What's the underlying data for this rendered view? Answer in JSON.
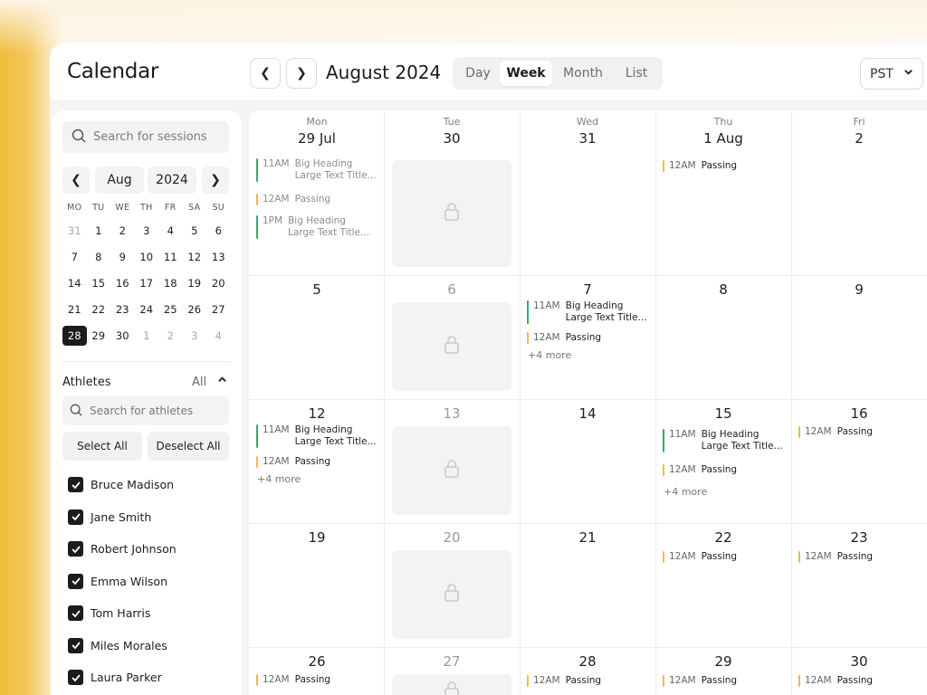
{
  "header": {
    "title": "Calendar",
    "period": "August 2024",
    "views": [
      "Day",
      "Week",
      "Month",
      "List"
    ],
    "active_view": "Week",
    "timezone": "PST"
  },
  "sidebar": {
    "session_search_placeholder": "Search for sessions",
    "mini_month": "Aug",
    "mini_year": "2024",
    "weekdays": [
      "MO",
      "TU",
      "WE",
      "TH",
      "FR",
      "SA",
      "SU"
    ],
    "weeks": [
      [
        "31",
        "1",
        "2",
        "3",
        "4",
        "5",
        "6"
      ],
      [
        "7",
        "8",
        "9",
        "10",
        "11",
        "12",
        "13"
      ],
      [
        "14",
        "15",
        "16",
        "17",
        "18",
        "19",
        "20"
      ],
      [
        "21",
        "22",
        "23",
        "24",
        "25",
        "26",
        "27"
      ],
      [
        "28",
        "29",
        "30",
        "1",
        "2",
        "3",
        "4"
      ]
    ],
    "selected_day": "28",
    "athletes_label": "Athletes",
    "athletes_filter": "All",
    "athlete_search_placeholder": "Search for athletes",
    "select_all": "Select All",
    "deselect_all": "Deselect All",
    "athletes": [
      "Bruce Madison",
      "Jane Smith",
      "Robert Johnson",
      "Emma Wilson",
      "Tom Harris",
      "Miles Morales",
      "Laura Parker"
    ]
  },
  "calendar": {
    "weekdays": [
      "Mon",
      "Tue",
      "Wed",
      "Thu",
      "Fri"
    ],
    "first_row_dates": [
      "29 Jul",
      "30",
      "31",
      "1 Aug",
      "2"
    ],
    "rows": [
      [
        "5",
        "6",
        "7",
        "8",
        "9"
      ],
      [
        "12",
        "13",
        "14",
        "15",
        "16"
      ],
      [
        "19",
        "20",
        "21",
        "22",
        "23"
      ],
      [
        "26",
        "27",
        "28",
        "29",
        "30"
      ]
    ],
    "event_time_11": "11AM",
    "event_time_12": "12AM",
    "event_time_1": "1PM",
    "event_heading": "Big Heading",
    "event_subtitle": "Large Text Title...",
    "event_passing": "Passing",
    "more_label": "+4 more",
    "colors": {
      "green": "#2fae6b",
      "amber": "#f2b84b"
    }
  }
}
